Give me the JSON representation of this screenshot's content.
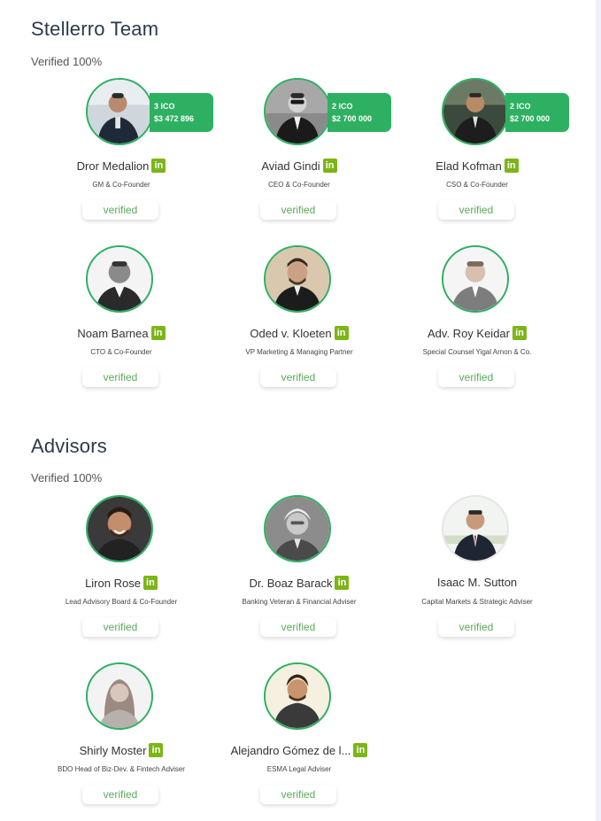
{
  "team": {
    "title": "Stellerro Team",
    "verified_text": "Verified 100%",
    "members": [
      {
        "name": "Dror Medalion",
        "role": "GM & Co-Founder",
        "ico_count": "3 ICO",
        "ico_amount": "$3 472 896",
        "status": "verified",
        "linkedin": "in"
      },
      {
        "name": "Aviad Gindi",
        "role": "CEO & Co-Founder",
        "ico_count": "2 ICO",
        "ico_amount": "$2 700 000",
        "status": "verified",
        "linkedin": "in"
      },
      {
        "name": "Elad Kofman",
        "role": "CSO & Co-Founder",
        "ico_count": "2 ICO",
        "ico_amount": "$2 700 000",
        "status": "verified",
        "linkedin": "in"
      },
      {
        "name": "Noam Barnea",
        "role": "CTO & Co-Founder",
        "status": "verified",
        "linkedin": "in"
      },
      {
        "name": "Oded v. Kloeten",
        "role": "VP Marketing & Managing Partner",
        "status": "verified",
        "linkedin": "in"
      },
      {
        "name": "Adv. Roy Keidar",
        "role": "Special Counsel Yigal Arnon & Co.",
        "status": "verified",
        "linkedin": "in"
      }
    ]
  },
  "advisors": {
    "title": "Advisors",
    "verified_text": "Verified 100%",
    "members": [
      {
        "name": "Liron Rose",
        "role": "Lead Advisory Board & Co-Founder",
        "status": "verified",
        "linkedin": "in"
      },
      {
        "name": "Dr. Boaz Barack",
        "role": "Banking Veteran & Financial Adviser",
        "status": "verified",
        "linkedin": "in"
      },
      {
        "name": "Isaac M. Sutton",
        "role": "Capital Markets & Strategic Adviser",
        "status": "verified"
      },
      {
        "name": "Shirly Moster",
        "role": "BDO Head of Biz-Dev. & Fintech Adviser",
        "status": "verified",
        "linkedin": "in"
      },
      {
        "name": "Alejandro Gómez de l...",
        "role": "ESMA Legal Adviser",
        "status": "verified",
        "linkedin": "in"
      }
    ]
  },
  "colors": {
    "accent": "#2eb062",
    "linkedin": "#7cb518",
    "verified_text": "#5aaa5a"
  }
}
